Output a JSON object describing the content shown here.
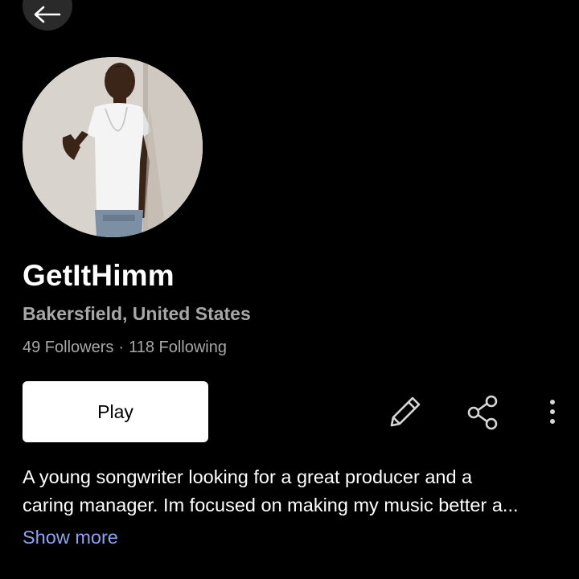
{
  "profile": {
    "name": "GetItHimm",
    "location": "Bakersfield, United States",
    "followers": "49 Followers",
    "separator": "·",
    "following": "118 Following",
    "bio_line1": "A young songwriter looking for a great producer and a",
    "bio_line2": "caring manager. Im focused on making my music better a...",
    "show_more": "Show more"
  },
  "actions": {
    "play_label": "Play"
  },
  "icons": {
    "back": "arrow-left-icon",
    "edit": "pencil-icon",
    "share": "share-icon",
    "more": "more-vertical-icon"
  },
  "colors": {
    "background": "#000000",
    "secondary_text": "#a7a7a7",
    "link": "#8ea2f0",
    "button_bg": "#ffffff"
  }
}
